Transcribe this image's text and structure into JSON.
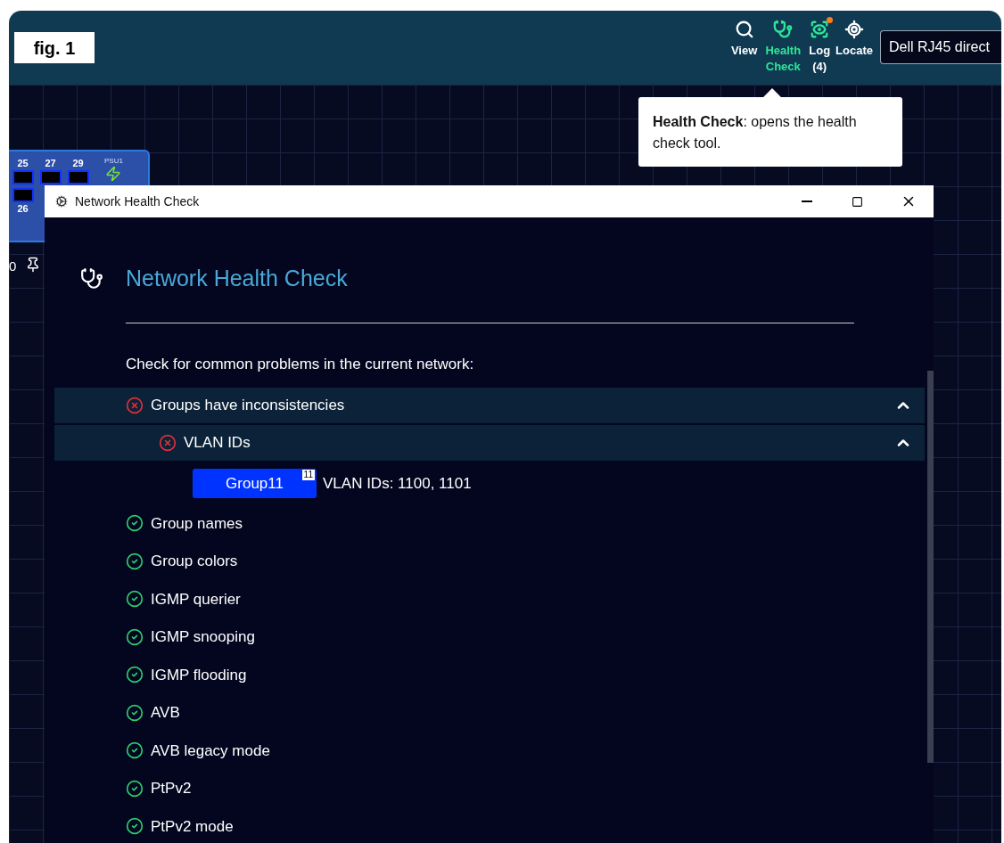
{
  "figure_label": "fig. 1",
  "toolbar": {
    "items": [
      {
        "kind": "view",
        "label": "View",
        "selected": false,
        "notification": false
      },
      {
        "kind": "health",
        "label": "Health Check",
        "selected": true,
        "notification": false
      },
      {
        "kind": "log",
        "label": "Log",
        "count": "(4)",
        "selected": false,
        "notification": true
      },
      {
        "kind": "locate",
        "label": "Locate",
        "selected": false,
        "notification": false
      }
    ],
    "device_select": {
      "value": "Dell RJ45 direct"
    }
  },
  "tooltip": {
    "text": "**Health Check**: opens the health check tool."
  },
  "canvas": {
    "device": {
      "top_ports": [
        "25",
        "27",
        "29"
      ],
      "bottom_ports": [
        "26"
      ],
      "psu_label": "PSU1"
    },
    "node_label": "0"
  },
  "dialog": {
    "window_title": "Network Health Check",
    "heading": "Network Health Check",
    "intro": "Check for common problems in the current network:",
    "checks": [
      {
        "kind": "check",
        "label": "Groups have inconsistencies",
        "failed": true,
        "expanded": true,
        "children": [
          {
            "kind": "check",
            "label": "VLAN IDs",
            "failed": true,
            "expanded": true,
            "children": [
              {
                "kind": "group",
                "group": "Group11",
                "badge": "11",
                "detail": "VLAN IDs: 1100, 1101"
              }
            ]
          }
        ]
      },
      {
        "kind": "check",
        "label": "Group names",
        "failed": false
      },
      {
        "kind": "check",
        "label": "Group colors",
        "failed": false
      },
      {
        "kind": "check",
        "label": "IGMP querier",
        "failed": false
      },
      {
        "kind": "check",
        "label": "IGMP snooping",
        "failed": false
      },
      {
        "kind": "check",
        "label": "IGMP flooding",
        "failed": false
      },
      {
        "kind": "check",
        "label": "AVB",
        "failed": false
      },
      {
        "kind": "check",
        "label": "AVB legacy mode",
        "failed": false
      },
      {
        "kind": "check",
        "label": "PtPv2",
        "failed": false
      },
      {
        "kind": "check",
        "label": "PtPv2 mode",
        "failed": false
      }
    ]
  }
}
